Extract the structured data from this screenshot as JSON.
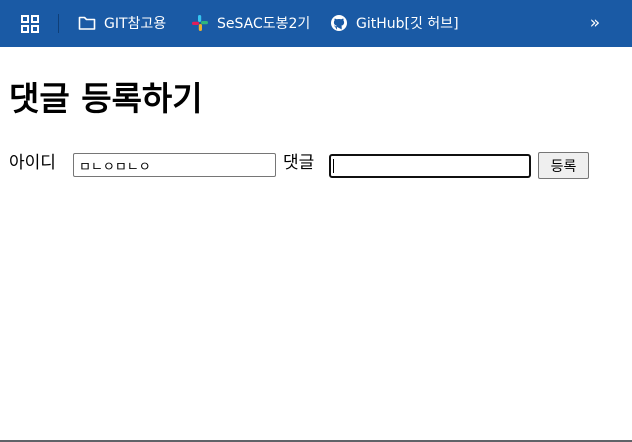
{
  "bookmarks_bar": {
    "apps_icon": "apps-grid-icon",
    "items": [
      {
        "label": "GIT참고용",
        "icon": "folder-icon"
      },
      {
        "label": "SeSAC도봉2기",
        "icon": "slack-icon"
      },
      {
        "label": "GitHub[깃 허브]",
        "icon": "github-icon"
      }
    ],
    "more_label": "»",
    "background": "#1a5aa5"
  },
  "page": {
    "title": "댓글 등록하기",
    "form": {
      "id_label": "아이디",
      "id_value": "ㅁㄴㅇㅁㄴㅇ",
      "comment_label": "댓글",
      "comment_value": "",
      "submit_label": "등록"
    }
  }
}
